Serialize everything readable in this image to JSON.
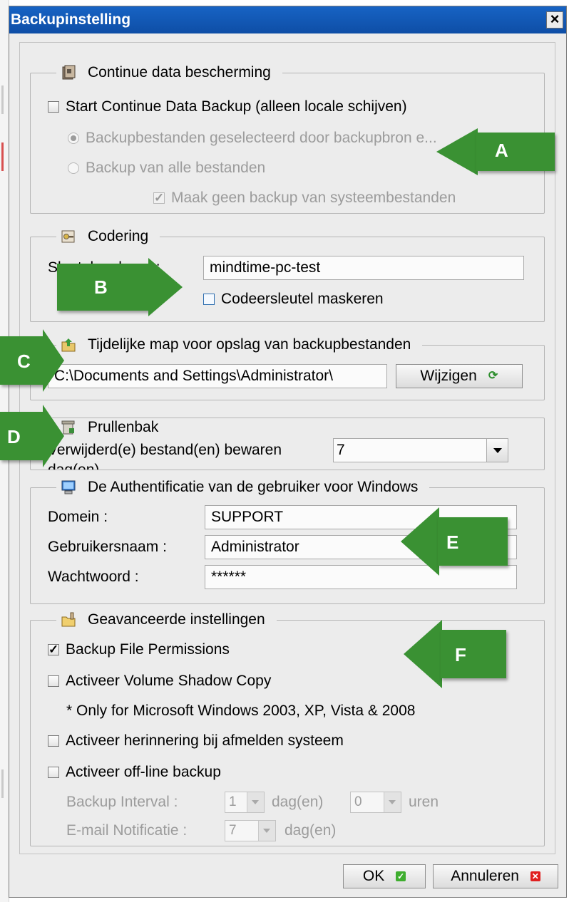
{
  "window": {
    "title": "Backupinstelling",
    "close_symbol": "×"
  },
  "cdp": {
    "legend": "Continue data bescherming",
    "icon": "cdp-safe-icon",
    "start_label": "Start Continue Data Backup (alleen locale schijven)",
    "start_checked": false,
    "radio_selected_label": "Backupbestanden geselecteerd door backupbron e...",
    "radio_all_label": "Backup van alle bestanden",
    "no_system_label": "Maak geen backup van systeembestanden",
    "no_system_checked": true
  },
  "encryption": {
    "legend": "Codering",
    "icon": "key-icon",
    "key_label": "Sleutel coderen :",
    "key_value": "mindtime-pc-test",
    "mask_label": "Codeersleutel maskeren",
    "mask_checked": false
  },
  "tempdir": {
    "legend": "Tijdelijke map voor opslag van backupbestanden",
    "icon": "folder-up-icon",
    "path_value": "C:\\Documents and Settings\\Administrator\\",
    "change_label": "Wijzigen",
    "change_icon": "refresh-icon"
  },
  "recycle": {
    "legend": "Prullenbak",
    "icon": "recycle-bin-icon",
    "keep_label": "Verwijderd(e) bestand(en) bewaren",
    "keep_value": "7",
    "unit_label": "dag(en)"
  },
  "windows_auth": {
    "legend": "De Authentificatie van de gebruiker voor Windows",
    "icon": "monitor-user-icon",
    "domain_label": "Domein :",
    "domain_value": "SUPPORT",
    "username_label": "Gebruikersnaam :",
    "username_value": "Administrator",
    "password_label": "Wachtwoord :",
    "password_value": "******"
  },
  "advanced": {
    "legend": "Geavanceerde instellingen",
    "icon": "folder-settings-icon",
    "file_permissions_label": "Backup File Permissions",
    "file_permissions_checked": true,
    "vss_label": "Activeer Volume Shadow Copy",
    "vss_checked": false,
    "vss_note": "* Only for Microsoft Windows 2003, XP, Vista & 2008",
    "reminder_label": "Activeer herinnering bij afmelden systeem",
    "reminder_checked": false,
    "offline_label": "Activeer off-line backup",
    "offline_checked": false,
    "interval_label": "Backup Interval :",
    "interval_days_value": "1",
    "interval_days_unit": "dag(en)",
    "interval_hours_value": "0",
    "interval_hours_unit": "uren",
    "email_label": "E-mail Notificatie :",
    "email_value": "7",
    "email_unit": "dag(en)"
  },
  "buttons": {
    "ok_label": "OK",
    "ok_icon": "check-icon",
    "cancel_label": "Annuleren",
    "cancel_icon": "x-icon"
  },
  "annotations": [
    "A",
    "B",
    "C",
    "D",
    "E",
    "F"
  ],
  "colors": {
    "titlebar": "#1763c4",
    "dialog_bg": "#ececec",
    "arrow_green": "#3a9133",
    "ok_green": "#3fae2f",
    "cancel_red": "#e02020"
  }
}
